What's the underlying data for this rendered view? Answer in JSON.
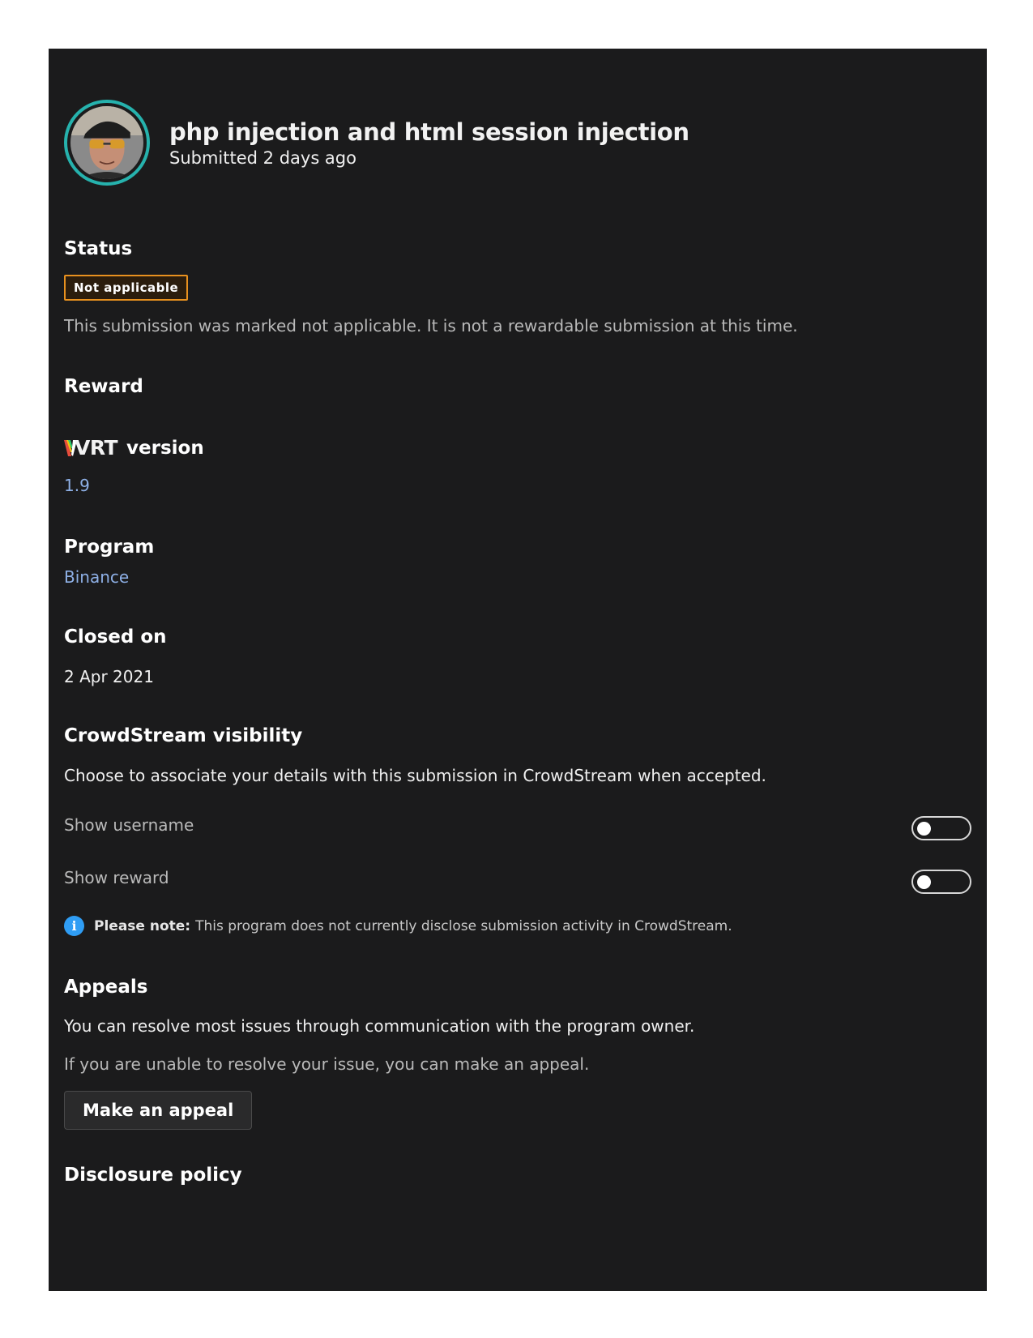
{
  "header": {
    "title": "php injection and html session injection",
    "subtitle": "Submitted 2 days ago"
  },
  "status": {
    "heading": "Status",
    "badge": "Not applicable",
    "badge_color": "#e8911f",
    "description": "This submission was marked not applicable. It is not a rewardable submission at this time."
  },
  "reward": {
    "heading": "Reward"
  },
  "vrt": {
    "logo": "VRT",
    "heading": "version",
    "value": "1.9"
  },
  "program": {
    "heading": "Program",
    "value": "Binance"
  },
  "closed": {
    "heading": "Closed on",
    "value": "2 Apr 2021"
  },
  "crowdstream": {
    "heading": "CrowdStream visibility",
    "description": "Choose to associate your details with this submission in CrowdStream when accepted.",
    "toggles": [
      {
        "label": "Show username",
        "on": false
      },
      {
        "label": "Show reward",
        "on": false
      }
    ],
    "note_label": "Please note:",
    "note_text": "This program does not currently disclose submission activity in CrowdStream.",
    "note_icon": "info-icon"
  },
  "appeals": {
    "heading": "Appeals",
    "line1": "You can resolve most issues through communication with the program owner.",
    "line2": "If you are unable to resolve your issue, you can make an appeal.",
    "button": "Make an appeal"
  },
  "disclosure": {
    "heading": "Disclosure policy"
  },
  "colors": {
    "panel_bg": "#1b1b1c",
    "avatar_ring": "#26b2ad",
    "link": "#8eb0e6",
    "info": "#2f9df4"
  }
}
